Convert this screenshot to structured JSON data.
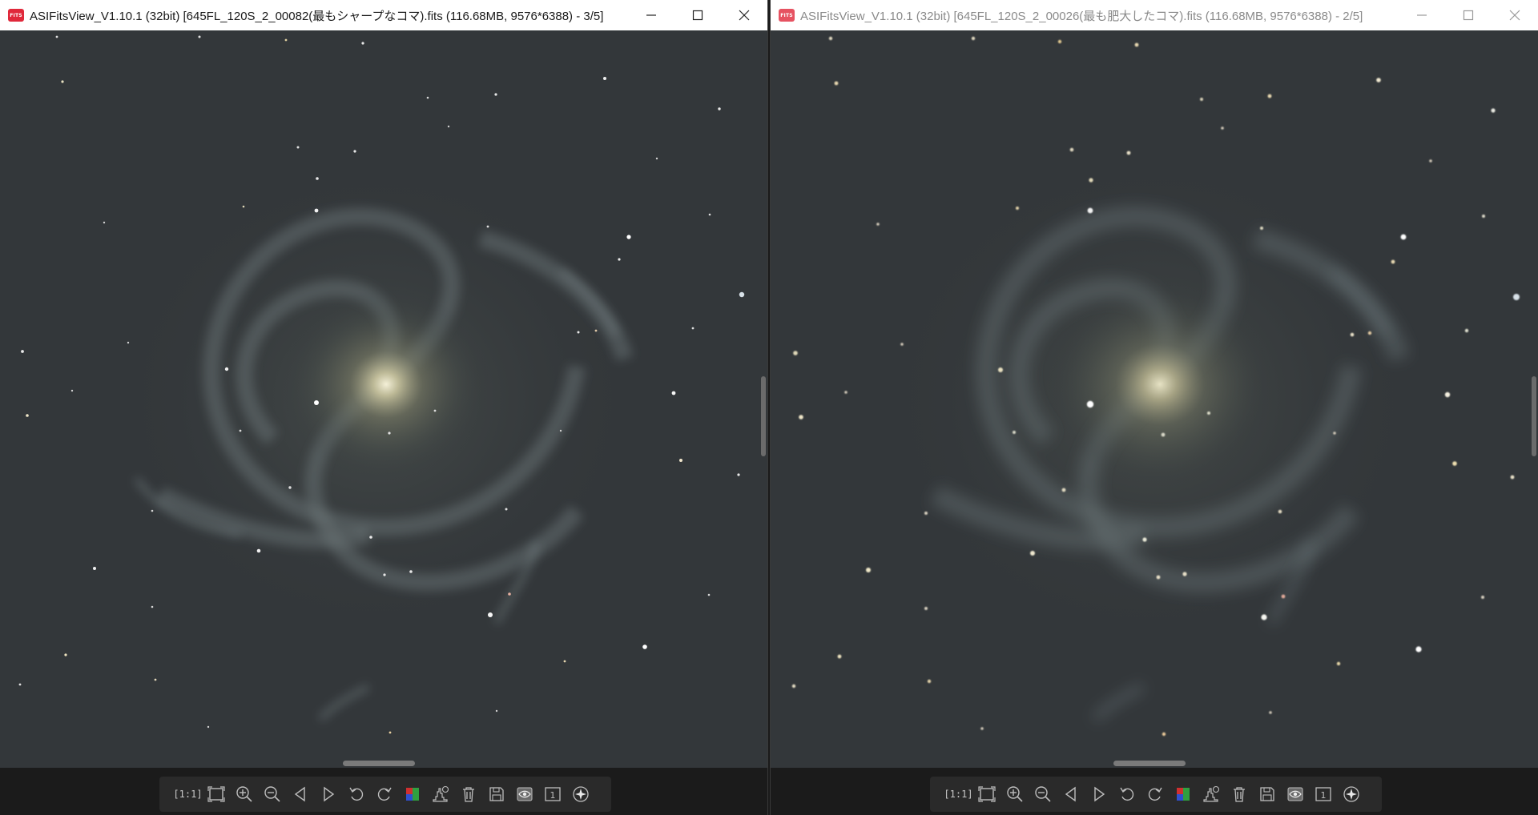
{
  "windows": [
    {
      "id": "left",
      "title": "ASIFitsView_V1.10.1 (32bit) [645FL_120S_2_00082(最もシャープなコマ).fits (116.68MB, 9576*6388) - 3/5]",
      "active": true
    },
    {
      "id": "right",
      "title": "ASIFitsView_V1.10.1 (32bit) [645FL_120S_2_00026(最も肥大したコマ).fits (116.68MB, 9576*6388) - 2/5]",
      "active": false
    }
  ],
  "app_icon_label": "FITS",
  "toolbar": {
    "fit_1to1_label": "1:1",
    "page_indicator": "1"
  },
  "icons": {
    "minimize": "minimize-icon",
    "maximize": "maximize-icon",
    "close": "close-icon"
  },
  "colors": {
    "sky": "#33373a",
    "titlebar": "#ffffff",
    "toolbar": "#2a2a2a",
    "app_icon": "#e0283a"
  }
}
